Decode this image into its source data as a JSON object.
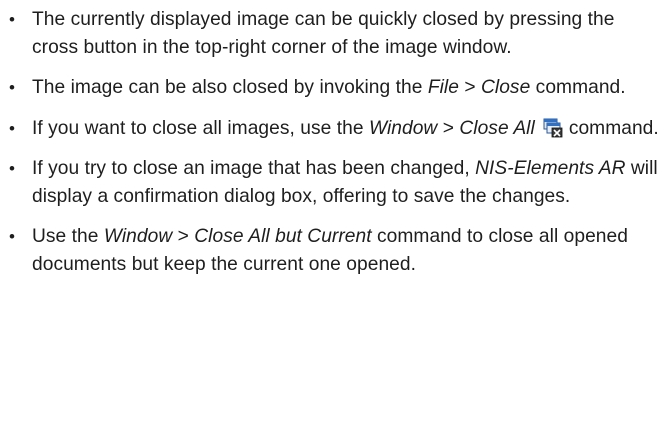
{
  "bullet_symbol": "•",
  "items": [
    {
      "text_a": "The currently displayed image can be quickly closed by pressing the cross button in the top-right corner of the image window."
    },
    {
      "text_a": "The image can be also closed by invoking the ",
      "menu_a": "File",
      "sep": " > ",
      "menu_b": "Close",
      "text_b": " command."
    },
    {
      "text_a": "If you want to close all images, use the ",
      "menu_a": "Window",
      "sep": " > ",
      "menu_b": "Close All",
      "icon": "close-all-windows-icon",
      "text_b": "command."
    },
    {
      "text_a": "If you try to close an image that has been changed, ",
      "app_name": "NIS-Elements AR",
      "text_b": " will display a confirmation dialog box, offering to save the changes."
    },
    {
      "text_a": "Use the ",
      "menu_a": "Window",
      "sep": " > ",
      "menu_b": "Close All but Current",
      "text_b": " command to close all opened documents but keep the current one opened."
    }
  ]
}
